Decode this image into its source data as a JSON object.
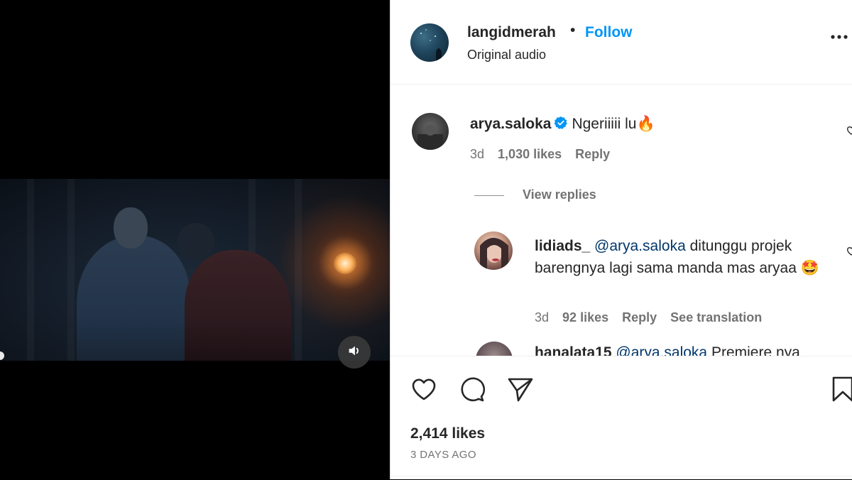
{
  "video": {
    "mute_icon": "speaker-icon"
  },
  "post": {
    "owner": "langidmerah",
    "separator": "•",
    "follow_label": "Follow",
    "audio_label": "Original audio",
    "more_icon": "more-horizontal-icon",
    "likes": "2,414 likes",
    "date": "3 DAYS AGO"
  },
  "comments": [
    {
      "user": "arya.saloka",
      "verified": true,
      "text": "Ngeriiiii lu🔥",
      "time": "3d",
      "likes": "1,030 likes",
      "reply_label": "Reply"
    }
  ],
  "view_replies_label": "View replies",
  "replies": [
    {
      "user": "lidiads_",
      "mention": "@arya.saloka",
      "text": "ditunggu projek barengnya lagi sama manda mas aryaa 🤩",
      "time": "3d",
      "likes": "92 likes",
      "reply_label": "Reply",
      "translation_label": "See translation"
    },
    {
      "user": "hanalata15",
      "mention": "@arya.saloka",
      "text": "Premiere nya"
    }
  ],
  "colors": {
    "link_blue": "#0095f6",
    "text": "#262626",
    "secondary": "#737373",
    "mention": "#00376b"
  }
}
